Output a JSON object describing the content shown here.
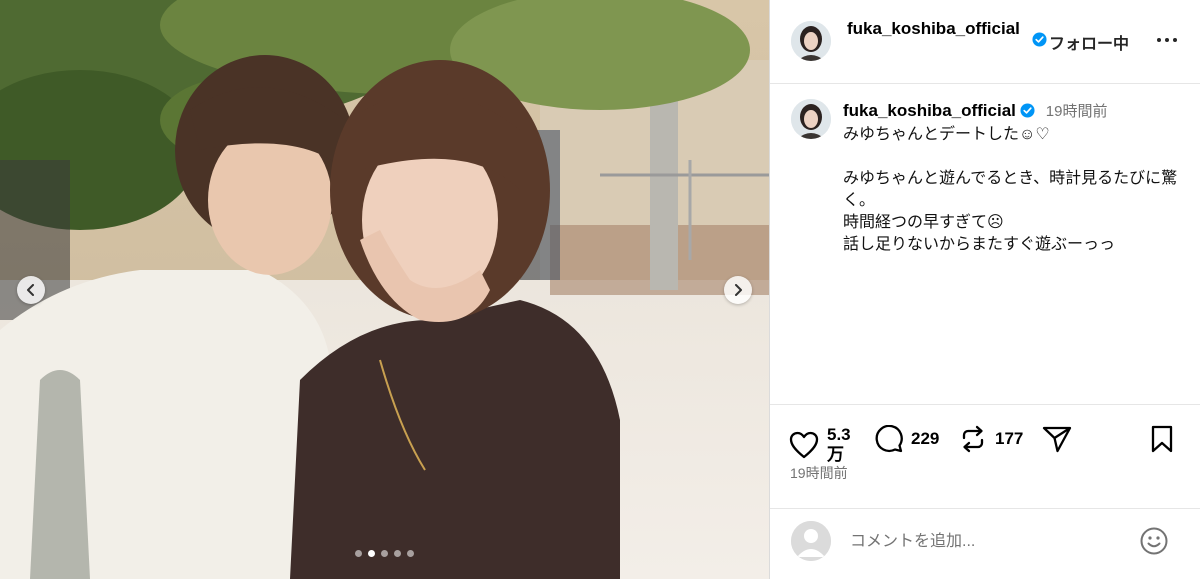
{
  "post": {
    "username": "fuka_koshiba_official",
    "follow_label": "フォロー中",
    "caption_time": "19時間前",
    "caption_lines": [
      "みゆちゃんとデートした☺︎♡",
      "",
      "みゆちゃんと遊んでるとき、時計見るたびに驚く。",
      "時間経つの早すぎて☹︎",
      "話し足りないからまたすぐ遊ぶーっっ"
    ],
    "likes": "5.3万",
    "comments": "229",
    "reposts": "177",
    "timestamp": "19時間前",
    "comment_placeholder": "コメントを追加...",
    "carousel": {
      "total": 5,
      "active_index": 1
    }
  },
  "icons": {
    "verified": "verified-badge-icon",
    "more": "more-options-icon",
    "like": "heart-icon",
    "comment": "comment-bubble-icon",
    "repost": "repost-icon",
    "share": "share-icon",
    "save": "bookmark-icon",
    "emoji": "emoji-icon",
    "prev": "chevron-left-icon",
    "next": "chevron-right-icon"
  },
  "colors": {
    "verified": "#0095f6",
    "muted": "#737373",
    "divider": "#dbdbdb"
  }
}
